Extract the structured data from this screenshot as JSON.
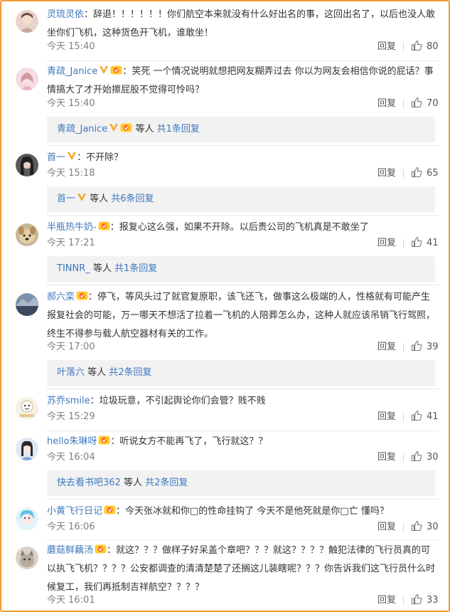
{
  "comments": [
    {
      "user": "灵琉灵依",
      "text": "：辞退！！！！！！你们航空本来就没有什么好出名的事，这回出名了，以后也没人敢坐你们飞机，这种货色开飞机，谁敢坐！",
      "time": "今天 15:40",
      "reply": "回复",
      "likes": "80"
    },
    {
      "user": "青疏_Janice",
      "text": "：笑死 一个情况说明就想把网友糊弄过去 你以为网友会相信你说的屁话？事情搞大了才开始擦屁股不觉得可怜吗？",
      "time": "今天 15:40",
      "reply": "回复",
      "likes": "70",
      "sub": {
        "user": "青疏_Janice",
        "mid": " 等人 ",
        "more": "共1条回复"
      }
    },
    {
      "user": "首一",
      "text": "：不开除？",
      "time": "今天 15:18",
      "reply": "回复",
      "likes": "65",
      "sub": {
        "user": "首一",
        "mid": " 等人 ",
        "more": "共6条回复"
      }
    },
    {
      "user": "半瓶热牛奶-",
      "text": "：报复心这么强，如果不开除。以后贵公司的飞机真是不敢坐了",
      "time": "今天 17:21",
      "reply": "回复",
      "likes": "41",
      "sub": {
        "user": "TINNR_",
        "mid": " 等人 ",
        "more": "共1条回复"
      }
    },
    {
      "user": "郝六栾",
      "text": "：停飞，等风头过了就官复原职，该飞还飞，做事这么极端的人，性格就有可能产生报复社会的可能，万一哪天不想活了拉着一飞机的人陪葬怎么办，这种人就应该吊销飞行驾照，终生不得参与载人航空器材有关的工作。",
      "time": "今天 17:00",
      "reply": "回复",
      "likes": "39",
      "sub": {
        "user": "叶落六",
        "mid": " 等人 ",
        "more": "共2条回复"
      }
    },
    {
      "user": "苏乔smile",
      "text": "：垃圾玩意，不引起舆论你们会管？贱不贱",
      "time": "今天 15:29",
      "reply": "回复",
      "likes": "41"
    },
    {
      "user": "hello朱琳呀",
      "text": "：听说女方不能再飞了，飞行就这？？",
      "time": "今天 16:04",
      "reply": "回复",
      "likes": "30",
      "sub": {
        "user": "快去看书吧362",
        "mid": " 等人 ",
        "more": "共2条回复"
      }
    },
    {
      "user": "小黄飞行日记",
      "text": "：今天张冰就和你□的性命挂钩了 今天不是他死就是你□亡 懂吗？",
      "time": "今天 16:06",
      "reply": "回复",
      "likes": "30"
    },
    {
      "user": "蘑菇鲜藕汤",
      "text": "：就这？？？做样子好呆盖个章吧？？？就这？？？？触犯法律的飞行员真的可以执飞飞机？？？？公安都调查的清清楚楚了还搁这儿装瞎呢？？？你告诉我们这飞行员什么时候复工，我们再抵制吉祥航空？？？？",
      "time": "今天 16:01",
      "reply": "回复",
      "likes": "33"
    }
  ],
  "watermark": "回复"
}
